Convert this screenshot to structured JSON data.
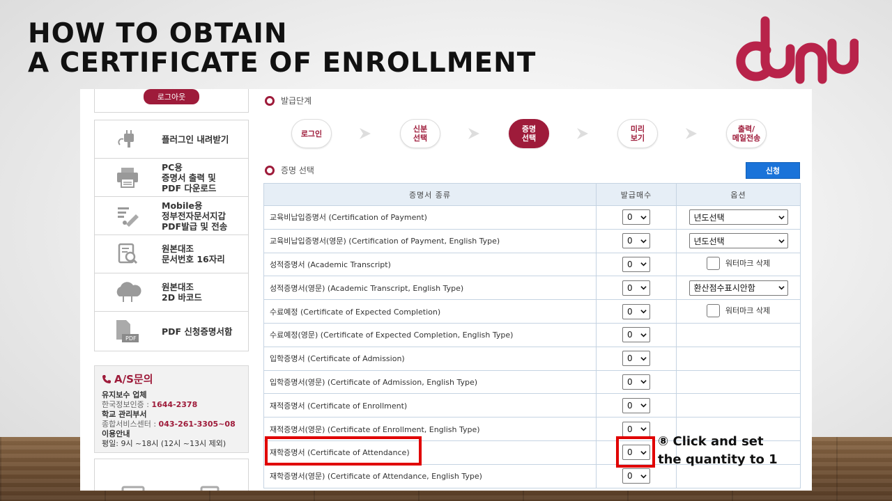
{
  "slide": {
    "title_line1": "HOW TO OBTAIN",
    "title_line2": "A CERTIFICATE OF ENROLLMENT",
    "callout_line1": "⑧ Click and set",
    "callout_line2": "the quantity to 1",
    "highlight_color": "#e00000"
  },
  "colors": {
    "brand": "#9e1b3a",
    "apply": "#1a73d9",
    "table_header_bg": "#e6eef6"
  },
  "sidebar": {
    "logout": "로그아웃",
    "items": [
      {
        "icon": "plugin-icon",
        "label": "플러그인 내려받기"
      },
      {
        "icon": "printer-icon",
        "label": "PC용\n증명서 출력 및\nPDF 다운로드"
      },
      {
        "icon": "mobile-wallet-icon",
        "label": "Mobile용\n정부전자문서지갑\nPDF발급 및 전송"
      },
      {
        "icon": "document-search-icon",
        "label": "원본대조\n문서번호 16자리"
      },
      {
        "icon": "cloud-barcode-icon",
        "label": "원본대조\n2D 바코드"
      },
      {
        "icon": "pdf-file-icon",
        "label": "PDF 신청증명서함"
      }
    ],
    "as": {
      "title": "A/S문의",
      "maint_label": "유지보수 업체",
      "maint_company": "한국정보인증 : ",
      "maint_phone": "1644-2378",
      "school_label": "학교 관리부서",
      "school_dept": "종합서비스센터 : ",
      "school_phone": "043-261-3305~08",
      "usage_label": "이용안내",
      "usage_hours": "평일: 9시 ~18시 (12시 ~13시 제외)"
    }
  },
  "main": {
    "steps_label": "발급단계",
    "steps": [
      "로그인",
      "신분\n선택",
      "증명\n선택",
      "미리\n보기",
      "출력/\n메일전송"
    ],
    "active_step": 2,
    "select_label": "증명 선택",
    "apply": "신청",
    "table": {
      "headers": [
        "증명서 종류",
        "발급매수",
        "옵션"
      ],
      "rows": [
        {
          "name": "교육비납입증명서 (Certification of Payment)",
          "qty": "0",
          "option": "년도선택",
          "option_type": "select"
        },
        {
          "name": "교육비납입증명서(영문) (Certification of Payment, English Type)",
          "qty": "0",
          "option": "년도선택",
          "option_type": "select"
        },
        {
          "name": "성적증명서 (Academic Transcript)",
          "qty": "0",
          "option": "워터마크 삭제",
          "option_type": "checkbox"
        },
        {
          "name": "성적증명서(영문) (Academic Transcript, English Type)",
          "qty": "0",
          "option": "환산점수표시안함",
          "option_type": "select"
        },
        {
          "name": "수료예정 (Certificate of Expected Completion)",
          "qty": "0",
          "option": "워터마크 삭제",
          "option_type": "checkbox"
        },
        {
          "name": "수료예정(영문) (Certificate of Expected Completion, English Type)",
          "qty": "0",
          "option": "",
          "option_type": "none"
        },
        {
          "name": "입학증명서 (Certificate of Admission)",
          "qty": "0",
          "option": "",
          "option_type": "none"
        },
        {
          "name": "입학증명서(영문) (Certificate of Admission, English Type)",
          "qty": "0",
          "option": "",
          "option_type": "none"
        },
        {
          "name": "재적증명서 (Certificate of Enrollment)",
          "qty": "0",
          "option": "",
          "option_type": "none"
        },
        {
          "name": "재적증명서(영문) (Certificate of Enrollment, English Type)",
          "qty": "0",
          "option": "",
          "option_type": "none"
        },
        {
          "name": "재학증명서 (Certificate of Attendance)",
          "qty": "0",
          "option": "",
          "option_type": "none"
        },
        {
          "name": "재학증명서(영문) (Certificate of Attendance, English Type)",
          "qty": "0",
          "option": "",
          "option_type": "none"
        }
      ]
    }
  }
}
